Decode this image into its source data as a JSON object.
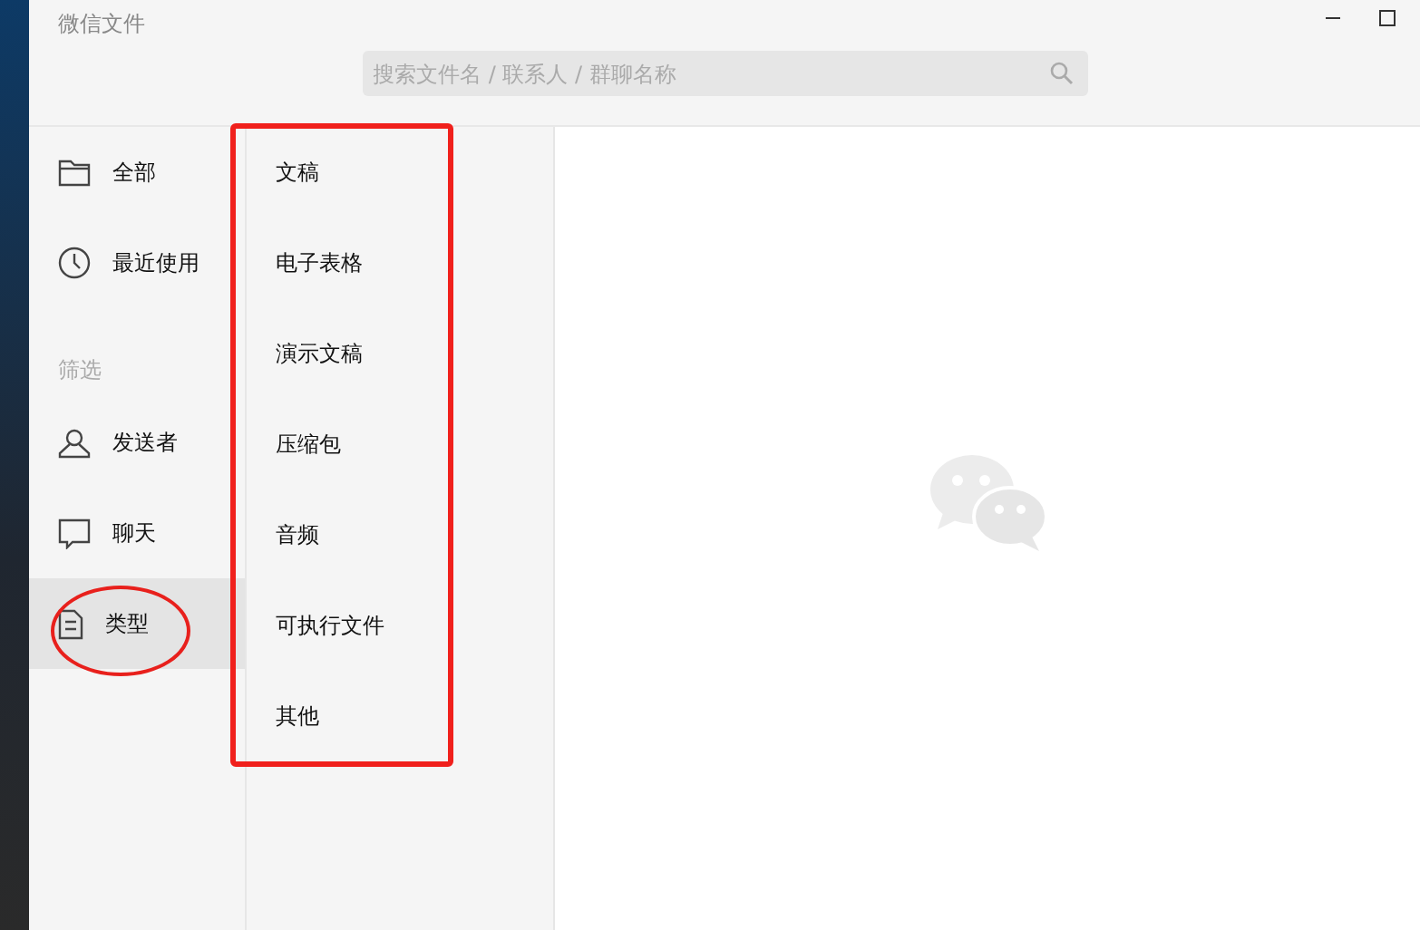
{
  "window": {
    "title": "微信文件"
  },
  "search": {
    "placeholder": "搜索文件名 / 联系人 / 群聊名称"
  },
  "sidebar": {
    "items": [
      {
        "label": "全部",
        "kind": "folder",
        "selected": false
      },
      {
        "label": "最近使用",
        "kind": "clock",
        "selected": false
      }
    ],
    "section_label": "筛选",
    "filter_items": [
      {
        "label": "发送者",
        "kind": "person",
        "selected": false
      },
      {
        "label": "聊天",
        "kind": "chat",
        "selected": false
      },
      {
        "label": "类型",
        "kind": "document",
        "selected": true
      }
    ]
  },
  "types": [
    {
      "label": "文稿"
    },
    {
      "label": "电子表格"
    },
    {
      "label": "演示文稿"
    },
    {
      "label": "压缩包"
    },
    {
      "label": "音频"
    },
    {
      "label": "可执行文件"
    },
    {
      "label": "其他"
    }
  ],
  "annotations": {
    "types_outlined": true,
    "selected_item_circled": true
  }
}
